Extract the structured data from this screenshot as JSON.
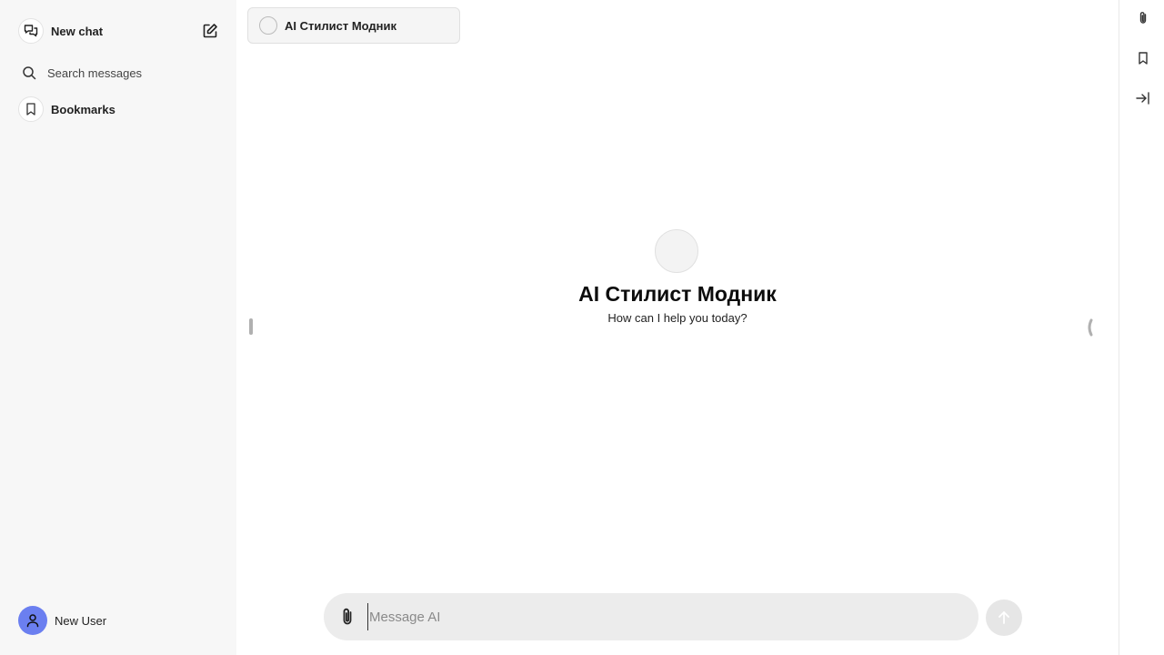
{
  "sidebar": {
    "new_chat_label": "New chat",
    "search_label": "Search messages",
    "bookmarks_label": "Bookmarks",
    "user_name": "New User",
    "avatar_color": "#6b7ff0"
  },
  "main": {
    "model_selector_label": "AI Стилист Модник",
    "hero_title": "AI Стилист Модник",
    "hero_subtitle": "How can I help you today?",
    "composer": {
      "placeholder": "Message AI",
      "value": ""
    }
  },
  "icons": {
    "new_chat": "chat-bubbles-icon",
    "edit": "edit-icon",
    "search": "search-icon",
    "bookmark": "bookmark-icon",
    "user": "user-icon",
    "attach": "paperclip-icon",
    "send": "arrow-up-icon",
    "collapse": "arrow-right-bar-icon"
  }
}
